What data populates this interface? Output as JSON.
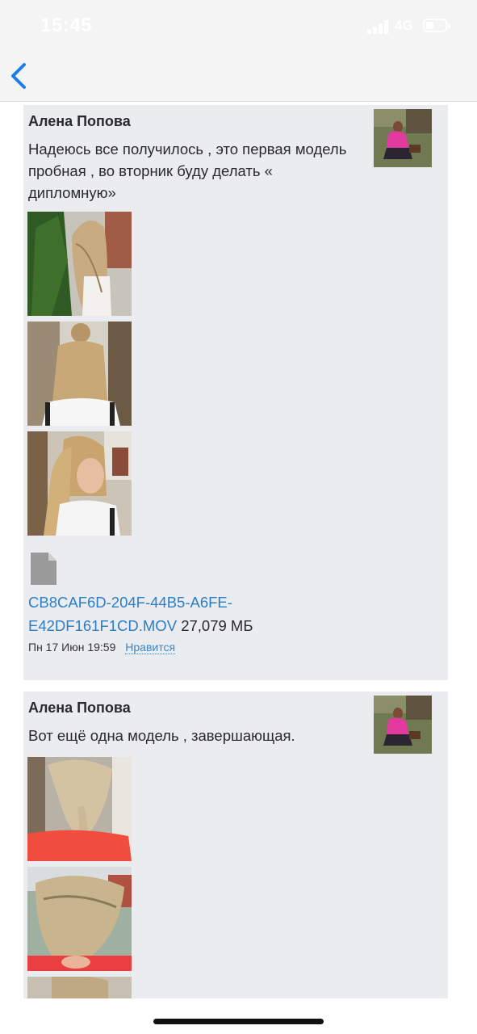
{
  "status_bar": {
    "time": "15:45",
    "network": "4G"
  },
  "nav": {
    "back_icon": "chevron-left-icon"
  },
  "posts": [
    {
      "author": "Алена Попова",
      "text_lines": [
        "Надеюсь все получилось , это первая модель",
        "пробная , во вторник буду делать «",
        "дипломную»"
      ],
      "attachment": {
        "icon": "file-icon",
        "name_line1": "CB8CAF6D-204F-44B5-A6FE-",
        "name_line2": "E42DF161F1CD.MOV",
        "size": "27,079 МБ"
      },
      "date": "Пн 17 Июн 19:59",
      "like_label": "Нравится"
    },
    {
      "author": "Алена Попова",
      "text_lines": [
        "Вот ещё одна модель , завершающая."
      ]
    }
  ],
  "colors": {
    "card_bg": "#ebecf0",
    "link": "#2c7ec7",
    "accent": "#1a7ee8"
  }
}
